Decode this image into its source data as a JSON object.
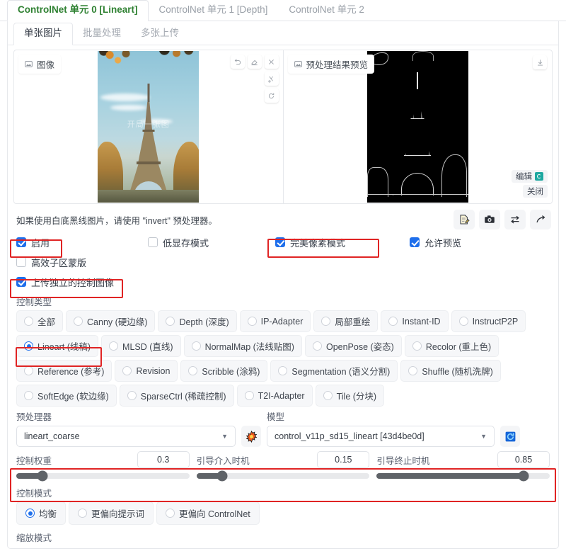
{
  "unit_tabs": [
    {
      "label": "ControlNet 单元 0 [Lineart]",
      "active": true
    },
    {
      "label": "ControlNet 单元 1 [Depth]",
      "active": false
    },
    {
      "label": "ControlNet 单元 2",
      "active": false
    }
  ],
  "sub_tabs": [
    {
      "label": "单张图片",
      "active": true
    },
    {
      "label": "批量处理",
      "active": false
    },
    {
      "label": "多张上传",
      "active": false
    }
  ],
  "image_panel": {
    "left_badge": "图像",
    "right_badge": "预处理结果预览",
    "watermark": "开局一张图",
    "edit_label": "编辑",
    "close_label": "关闭",
    "tools": [
      "undo-icon",
      "erase-icon",
      "close-icon",
      "scissors-icon",
      "refresh-icon"
    ],
    "download_icon": "download-icon"
  },
  "hint": {
    "text": "如果使用白底黑线图片，请使用 \"invert\" 预处理器。",
    "icons": [
      "note-edit-icon",
      "camera-icon",
      "swap-icon",
      "arrow-send-icon"
    ]
  },
  "checkboxes": {
    "row1": [
      {
        "label": "启用",
        "checked": true,
        "highlight": true
      },
      {
        "label": "低显存模式",
        "checked": false,
        "highlight": false
      },
      {
        "label": "完美像素模式",
        "checked": true,
        "highlight": true
      },
      {
        "label": "允许预览",
        "checked": true,
        "highlight": false
      }
    ],
    "row2": [
      {
        "label": "高效子区蒙版",
        "checked": false,
        "highlight": false
      }
    ],
    "row3": [
      {
        "label": "上传独立的控制图像",
        "checked": true,
        "highlight": true
      }
    ]
  },
  "control_type": {
    "label": "控制类型",
    "rows": [
      [
        {
          "label": "全部",
          "selected": false
        },
        {
          "label": "Canny (硬边缘)",
          "selected": false
        },
        {
          "label": "Depth (深度)",
          "selected": false
        },
        {
          "label": "IP-Adapter",
          "selected": false
        },
        {
          "label": "局部重绘",
          "selected": false
        },
        {
          "label": "Instant-ID",
          "selected": false
        },
        {
          "label": "InstructP2P",
          "selected": false
        }
      ],
      [
        {
          "label": "Lineart (线稿)",
          "selected": true
        },
        {
          "label": "MLSD (直线)",
          "selected": false
        },
        {
          "label": "NormalMap (法线贴图)",
          "selected": false
        },
        {
          "label": "OpenPose (姿态)",
          "selected": false
        },
        {
          "label": "Recolor (重上色)",
          "selected": false
        }
      ],
      [
        {
          "label": "Reference (参考)",
          "selected": false
        },
        {
          "label": "Revision",
          "selected": false
        },
        {
          "label": "Scribble (涂鸦)",
          "selected": false
        },
        {
          "label": "Segmentation (语义分割)",
          "selected": false
        },
        {
          "label": "Shuffle (随机洗牌)",
          "selected": false
        }
      ],
      [
        {
          "label": "SoftEdge (软边缘)",
          "selected": false
        },
        {
          "label": "SparseCtrl (稀疏控制)",
          "selected": false
        },
        {
          "label": "T2I-Adapter",
          "selected": false
        },
        {
          "label": "Tile (分块)",
          "selected": false
        }
      ]
    ]
  },
  "preprocessor": {
    "label": "预处理器",
    "value": "lineart_coarse",
    "run_icon": "explosion-icon"
  },
  "model": {
    "label": "模型",
    "value": "control_v11p_sd15_lineart [43d4be0d]",
    "refresh_icon": "refresh-icon"
  },
  "sliders": [
    {
      "name": "控制权重",
      "value": "0.3",
      "percent": 15
    },
    {
      "name": "引导介入时机",
      "value": "0.15",
      "percent": 15
    },
    {
      "name": "引导终止时机",
      "value": "0.85",
      "percent": 85
    }
  ],
  "control_mode": {
    "label": "控制模式",
    "options": [
      {
        "label": "均衡",
        "selected": true
      },
      {
        "label": "更偏向提示词",
        "selected": false
      },
      {
        "label": "更偏向 ControlNet",
        "selected": false
      }
    ]
  },
  "scale_mode": {
    "label": "缩放模式"
  },
  "colors": {
    "accent_green": "#2f8132",
    "accent_blue": "#1f6feb",
    "highlight_red": "#e02424",
    "slider_gray": "#5f6368"
  }
}
